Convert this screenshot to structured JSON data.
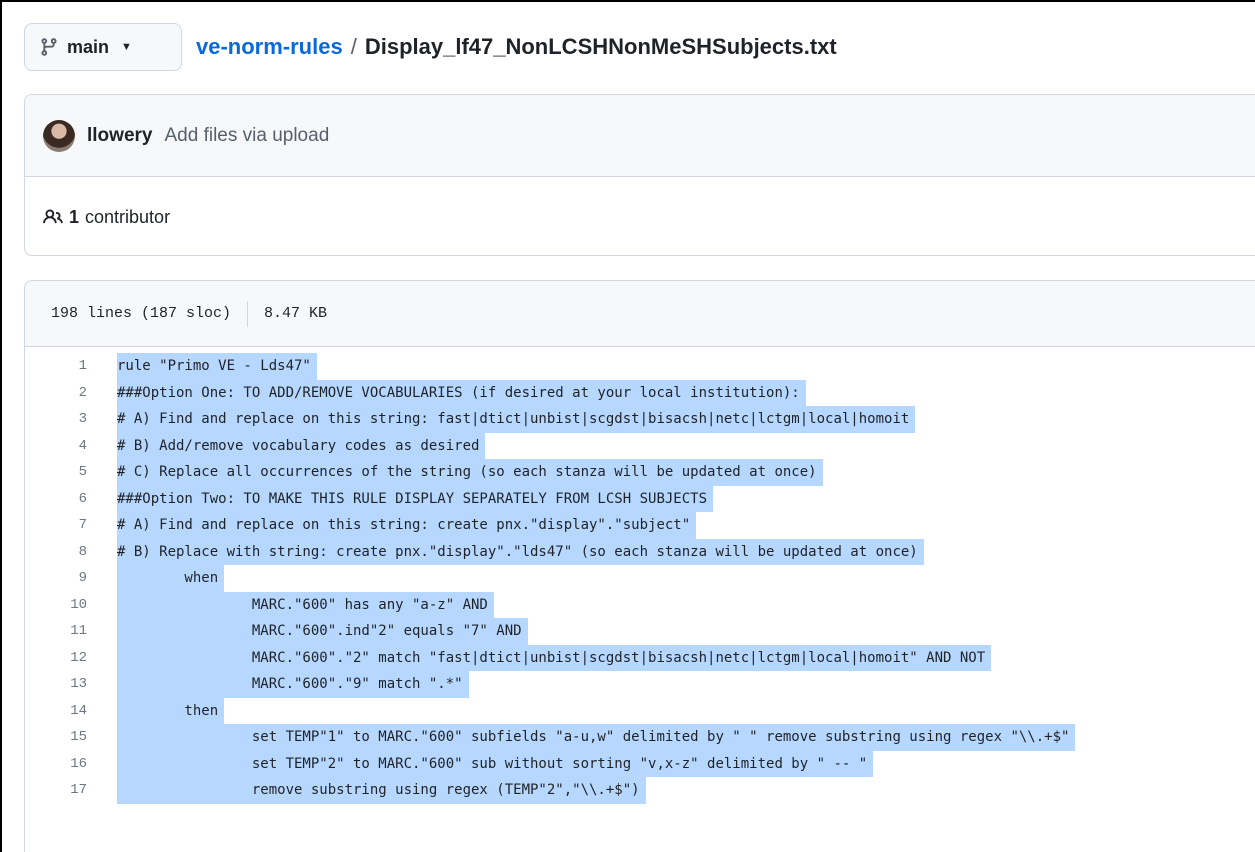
{
  "branch": {
    "label": "main"
  },
  "breadcrumb": {
    "repo": "ve-norm-rules",
    "separator": "/",
    "file": "Display_lf47_NonLCSHNonMeSHSubjects.txt"
  },
  "commit": {
    "author": "llowery",
    "message": "Add files via upload"
  },
  "contributors": {
    "count": "1",
    "label": "contributor"
  },
  "file_info": {
    "lines": "198 lines (187 sloc)",
    "size": "8.47 KB"
  },
  "code_lines": [
    {
      "n": "1",
      "text": "rule \"Primo VE - Lds47\""
    },
    {
      "n": "2",
      "text": "###Option One: TO ADD/REMOVE VOCABULARIES (if desired at your local institution):"
    },
    {
      "n": "3",
      "text": "# A) Find and replace on this string: fast|dtict|unbist|scgdst|bisacsh|netc|lctgm|local|homoit"
    },
    {
      "n": "4",
      "text": "# B) Add/remove vocabulary codes as desired"
    },
    {
      "n": "5",
      "text": "# C) Replace all occurrences of the string (so each stanza will be updated at once)"
    },
    {
      "n": "6",
      "text": "###Option Two: TO MAKE THIS RULE DISPLAY SEPARATELY FROM LCSH SUBJECTS"
    },
    {
      "n": "7",
      "text": "# A) Find and replace on this string: create pnx.\"display\".\"subject\""
    },
    {
      "n": "8",
      "text": "# B) Replace with string: create pnx.\"display\".\"lds47\" (so each stanza will be updated at once)"
    },
    {
      "n": "9",
      "text": "        when"
    },
    {
      "n": "10",
      "text": "                MARC.\"600\" has any \"a-z\" AND"
    },
    {
      "n": "11",
      "text": "                MARC.\"600\".ind\"2\" equals \"7\" AND"
    },
    {
      "n": "12",
      "text": "                MARC.\"600\".\"2\" match \"fast|dtict|unbist|scgdst|bisacsh|netc|lctgm|local|homoit\" AND NOT"
    },
    {
      "n": "13",
      "text": "                MARC.\"600\".\"9\" match \".*\""
    },
    {
      "n": "14",
      "text": "        then"
    },
    {
      "n": "15",
      "text": "                set TEMP\"1\" to MARC.\"600\" subfields \"a-u,w\" delimited by \" \" remove substring using regex \"\\\\.+$\""
    },
    {
      "n": "16",
      "text": "                set TEMP\"2\" to MARC.\"600\" sub without sorting \"v,x-z\" delimited by \" -- \""
    },
    {
      "n": "17",
      "text": "                remove substring using regex (TEMP\"2\",\"\\\\.+$\")"
    }
  ],
  "icons": {
    "branch": "git-branch-icon",
    "caret": "chevron-down-icon",
    "contributors": "people-icon",
    "avatar": "avatar"
  },
  "colors": {
    "link": "#0969da",
    "selection": "#b6d7ff",
    "border": "#d0d7de",
    "header_bg": "#f6f8fa"
  }
}
